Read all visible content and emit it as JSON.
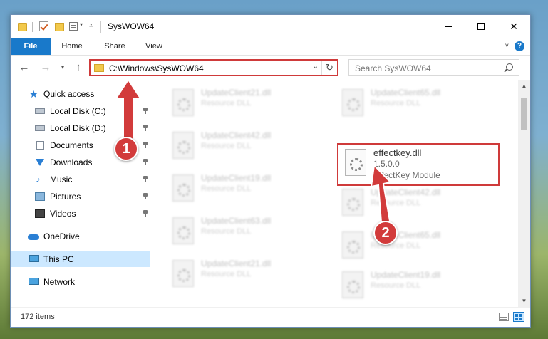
{
  "window": {
    "title": "SysWOW64"
  },
  "ribbon": {
    "tabs": [
      "File",
      "Home",
      "Share",
      "View"
    ]
  },
  "address": {
    "path": "C:\\Windows\\SysWOW64",
    "search_placeholder": "Search SysWOW64"
  },
  "sidebar": {
    "items": [
      {
        "label": "Quick access",
        "icon": "star-icon"
      },
      {
        "label": "Local Disk (C:)",
        "icon": "disk-icon",
        "pinned": true
      },
      {
        "label": "Local Disk (D:)",
        "icon": "disk-icon",
        "pinned": true
      },
      {
        "label": "Documents",
        "icon": "document-icon",
        "pinned": true
      },
      {
        "label": "Downloads",
        "icon": "download-icon",
        "pinned": true
      },
      {
        "label": "Music",
        "icon": "music-icon",
        "pinned": true
      },
      {
        "label": "Pictures",
        "icon": "picture-icon",
        "pinned": true
      },
      {
        "label": "Videos",
        "icon": "video-icon",
        "pinned": true
      },
      {
        "label": "OneDrive",
        "icon": "cloud-icon"
      },
      {
        "label": "This PC",
        "icon": "computer-icon",
        "selected": true
      },
      {
        "label": "Network",
        "icon": "network-icon"
      }
    ]
  },
  "files": {
    "left_column": [
      {
        "name": "UpdateClient21.dll",
        "type": "Resource DLL"
      },
      {
        "name": "UpdateClient42.dll",
        "type": "Resource DLL"
      },
      {
        "name": "UpdateClient19.dll",
        "type": "Resource DLL"
      },
      {
        "name": "UpdateClient63.dll",
        "type": "Resource DLL"
      },
      {
        "name": "UpdateClient21.dll",
        "type": "Resource DLL"
      }
    ],
    "right_column": [
      {
        "name": "UpdateClient65.dll",
        "type": "Resource DLL"
      },
      {
        "name": "effectkey.dll",
        "version": "1.5.0.0",
        "type": "EffectKey Module",
        "highlighted": true
      },
      {
        "name": "UpdateClient42.dll",
        "type": "Resource DLL"
      },
      {
        "name": "UpdateClient65.dll",
        "type": "Resource DLL"
      },
      {
        "name": "UpdateClient19.dll",
        "type": "Resource DLL"
      }
    ]
  },
  "status": {
    "item_count": "172 items"
  },
  "annotations": {
    "step1": "1",
    "step2": "2",
    "accent_color": "#d23b3b"
  }
}
